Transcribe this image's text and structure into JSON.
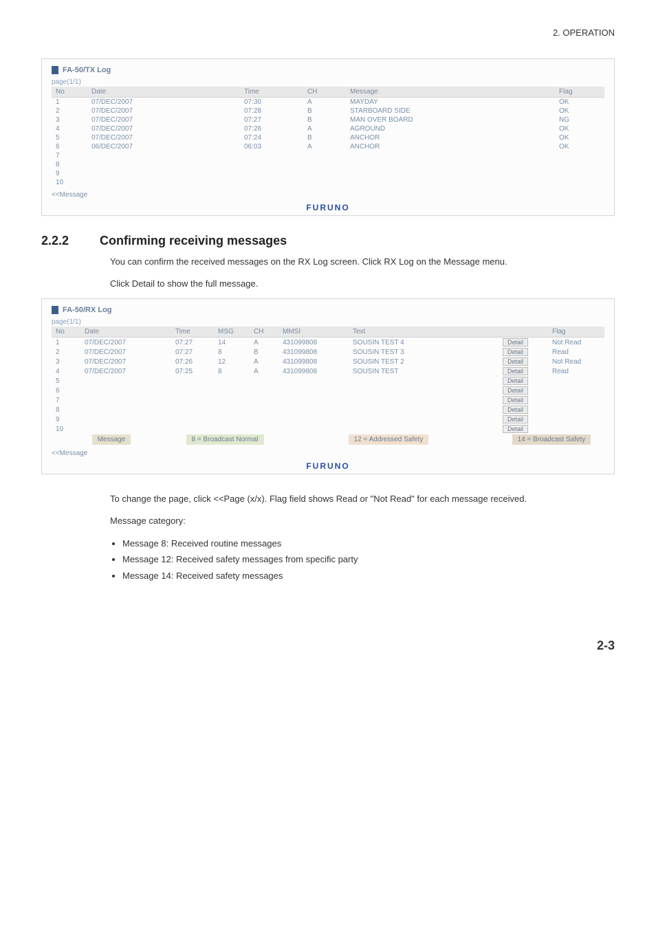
{
  "header": {
    "chapter": "2.  OPERATION"
  },
  "tx_log": {
    "title": "FA-50/TX Log",
    "page_label": "page(1/1)",
    "cols": [
      "No",
      "Date",
      "Time",
      "CH",
      "Message",
      "Flag"
    ],
    "rows": [
      {
        "no": "1",
        "date": "07/DEC/2007",
        "time": "07:30",
        "ch": "A",
        "msg": "MAYDAY",
        "flag": "OK"
      },
      {
        "no": "2",
        "date": "07/DEC/2007",
        "time": "07:28",
        "ch": "B",
        "msg": "STARBOARD SIDE",
        "flag": "OK"
      },
      {
        "no": "3",
        "date": "07/DEC/2007",
        "time": "07:27",
        "ch": "B",
        "msg": "MAN OVER BOARD",
        "flag": "NG"
      },
      {
        "no": "4",
        "date": "07/DEC/2007",
        "time": "07:26",
        "ch": "A",
        "msg": "AGROUND",
        "flag": "OK"
      },
      {
        "no": "5",
        "date": "07/DEC/2007",
        "time": "07:24",
        "ch": "B",
        "msg": "ANCHOR",
        "flag": "OK"
      },
      {
        "no": "6",
        "date": "06/DEC/2007",
        "time": "06:03",
        "ch": "A",
        "msg": "ANCHOR",
        "flag": "OK"
      },
      {
        "no": "7",
        "date": "",
        "time": "",
        "ch": "",
        "msg": "",
        "flag": ""
      },
      {
        "no": "8",
        "date": "",
        "time": "",
        "ch": "",
        "msg": "",
        "flag": ""
      },
      {
        "no": "9",
        "date": "",
        "time": "",
        "ch": "",
        "msg": "",
        "flag": ""
      },
      {
        "no": "10",
        "date": "",
        "time": "",
        "ch": "",
        "msg": "",
        "flag": ""
      }
    ],
    "link": "<<Message",
    "brand": "FURUNO"
  },
  "section": {
    "num": "2.2.2",
    "title": "Confirming receiving messages",
    "p1": "You can confirm the received messages on the RX Log screen. Click RX Log on the Message menu.",
    "p2": "Click Detail to show the full message."
  },
  "rx_log": {
    "title": "FA-50/RX Log",
    "page_label": "page(1/1)",
    "cols": [
      "No",
      "Date",
      "Time",
      "MSG",
      "CH",
      "MMSI",
      "Text",
      "",
      "Flag"
    ],
    "rows": [
      {
        "no": "1",
        "date": "07/DEC/2007",
        "time": "07:27",
        "msg": "14",
        "ch": "A",
        "mmsi": "431099808",
        "text": "SOUSIN TEST 4",
        "btn": "Detail",
        "flag": "Not Read"
      },
      {
        "no": "2",
        "date": "07/DEC/2007",
        "time": "07:27",
        "msg": "8",
        "ch": "B",
        "mmsi": "431099808",
        "text": "SOUSIN TEST 3",
        "btn": "Detail",
        "flag": "Read"
      },
      {
        "no": "3",
        "date": "07/DEC/2007",
        "time": "07:26",
        "msg": "12",
        "ch": "A",
        "mmsi": "431099808",
        "text": "SOUSIN TEST 2",
        "btn": "Detail",
        "flag": "Not Read"
      },
      {
        "no": "4",
        "date": "07/DEC/2007",
        "time": "07:25",
        "msg": "8",
        "ch": "A",
        "mmsi": "431099808",
        "text": "SOUSIN TEST",
        "btn": "Detail",
        "flag": "Read"
      },
      {
        "no": "5",
        "date": "",
        "time": "",
        "msg": "",
        "ch": "",
        "mmsi": "",
        "text": "",
        "btn": "Detail",
        "flag": ""
      },
      {
        "no": "6",
        "date": "",
        "time": "",
        "msg": "",
        "ch": "",
        "mmsi": "",
        "text": "",
        "btn": "Detail",
        "flag": ""
      },
      {
        "no": "7",
        "date": "",
        "time": "",
        "msg": "",
        "ch": "",
        "mmsi": "",
        "text": "",
        "btn": "Detail",
        "flag": ""
      },
      {
        "no": "8",
        "date": "",
        "time": "",
        "msg": "",
        "ch": "",
        "mmsi": "",
        "text": "",
        "btn": "Detail",
        "flag": ""
      },
      {
        "no": "9",
        "date": "",
        "time": "",
        "msg": "",
        "ch": "",
        "mmsi": "",
        "text": "",
        "btn": "Detail",
        "flag": ""
      },
      {
        "no": "10",
        "date": "",
        "time": "",
        "msg": "",
        "ch": "",
        "mmsi": "",
        "text": "",
        "btn": "Detail",
        "flag": ""
      }
    ],
    "cats": {
      "msg": "Message",
      "c8": "8 = Broadcast Normal",
      "c12": "12 = Addressed Safety",
      "c14": "14 = Broadcast Safety"
    },
    "link": "<<Message",
    "brand": "FURUNO"
  },
  "after": {
    "p1": "To change the page, click <<Page (x/x). Flag field shows Read or \"Not Read\" for each message received.",
    "p2": "Message category:",
    "b1": "Message 8: Received routine messages",
    "b2": "Message 12: Received safety messages from specific party",
    "b3": "Message 14: Received safety messages"
  },
  "footer": {
    "page": "2-3"
  }
}
